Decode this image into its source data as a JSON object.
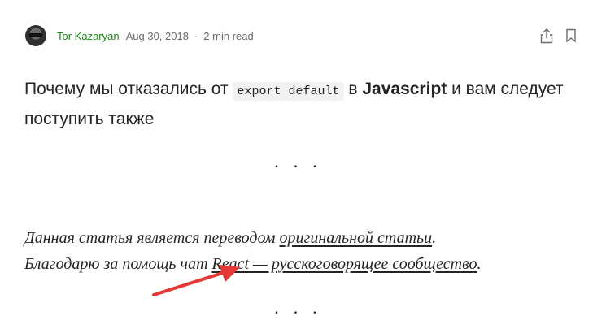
{
  "author": {
    "name": "Tor Kazaryan",
    "date": "Aug 30, 2018",
    "read_time": "2 min read",
    "separator": "·"
  },
  "actions": {
    "share_icon": "share-icon",
    "bookmark_icon": "bookmark-icon"
  },
  "article": {
    "title_part1": "Почему мы отказались от",
    "title_code": "export default",
    "title_part2": "в",
    "title_bold": "Javascript",
    "title_part3": "и вам следует поступить также",
    "divider": "...",
    "line1_prefix": "Данная статья является переводом",
    "line1_link": "оригинальной статьи",
    "line1_suffix": ".",
    "line2_prefix": "Благодарю за помощь чат",
    "line2_link": "React — русскоговорящее сообщество",
    "line2_suffix": "."
  },
  "annotation": {
    "arrow_color": "#e53935"
  },
  "colors": {
    "author": "#1a8917",
    "meta": "#6b6b6b",
    "text": "#242424"
  }
}
